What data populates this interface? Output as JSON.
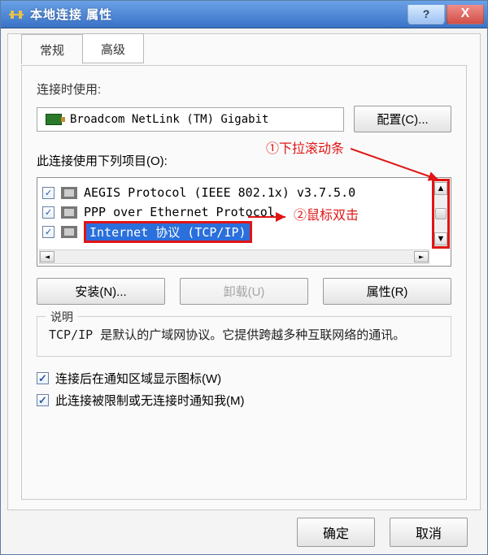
{
  "window": {
    "title": "本地连接 属性"
  },
  "tabs": {
    "general": "常规",
    "advanced": "高级"
  },
  "connect_using_label": "连接时使用:",
  "adapter": {
    "name": "Broadcom NetLink (TM) Gigabit"
  },
  "buttons": {
    "configure": "配置(C)...",
    "install": "安装(N)...",
    "uninstall": "卸载(U)",
    "properties": "属性(R)",
    "ok": "确定",
    "cancel": "取消"
  },
  "items_label": "此连接使用下列项目(O):",
  "items": [
    {
      "checked": true,
      "label": "AEGIS Protocol (IEEE 802.1x) v3.7.5.0"
    },
    {
      "checked": true,
      "label": "PPP over Ethernet Protocol"
    },
    {
      "checked": true,
      "label": "Internet 协议 (TCP/IP)"
    }
  ],
  "description": {
    "legend": "说明",
    "text": "TCP/IP 是默认的广域网协议。它提供跨越多种互联网络的通讯。"
  },
  "options": {
    "show_icon": "连接后在通知区域显示图标(W)",
    "notify_limited": "此连接被限制或无连接时通知我(M)"
  },
  "annotations": {
    "step1": "①下拉滚动条",
    "step2": "②鼠标双击"
  }
}
